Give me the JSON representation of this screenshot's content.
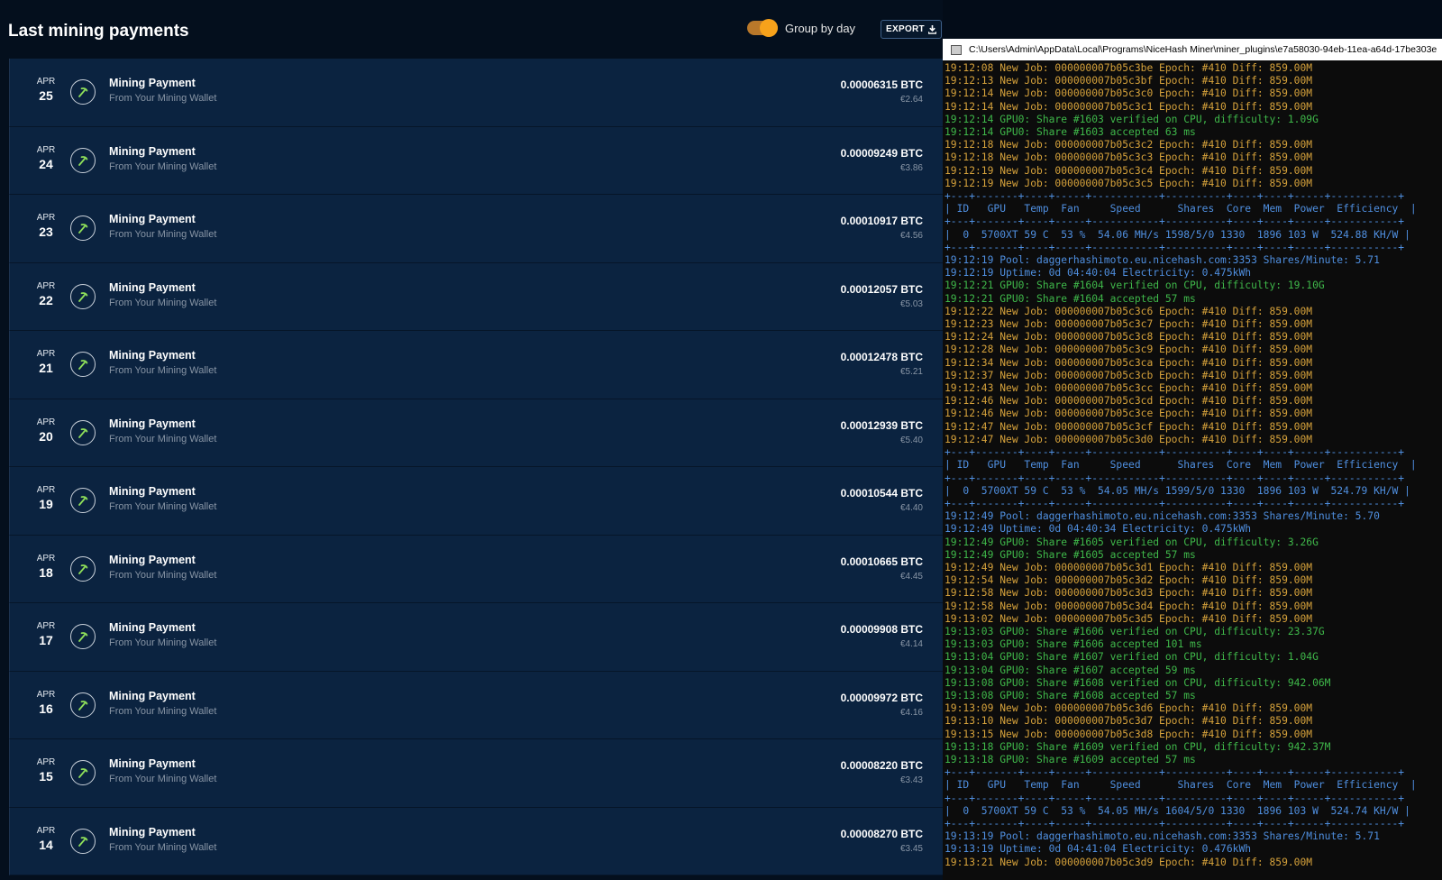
{
  "header": {
    "title": "Last mining payments",
    "group_label": "Group by day",
    "export_label": "EXPORT"
  },
  "colors": {
    "accent": "#f7a21b",
    "row_bg": "#0b2340",
    "icon_green": "#8fe05a"
  },
  "payments": [
    {
      "month": "APR",
      "day": "25",
      "title": "Mining Payment",
      "subtitle": "From Your Mining Wallet",
      "btc": "0.00006315 BTC",
      "eur": "€2.64"
    },
    {
      "month": "APR",
      "day": "24",
      "title": "Mining Payment",
      "subtitle": "From Your Mining Wallet",
      "btc": "0.00009249 BTC",
      "eur": "€3.86"
    },
    {
      "month": "APR",
      "day": "23",
      "title": "Mining Payment",
      "subtitle": "From Your Mining Wallet",
      "btc": "0.00010917 BTC",
      "eur": "€4.56"
    },
    {
      "month": "APR",
      "day": "22",
      "title": "Mining Payment",
      "subtitle": "From Your Mining Wallet",
      "btc": "0.00012057 BTC",
      "eur": "€5.03"
    },
    {
      "month": "APR",
      "day": "21",
      "title": "Mining Payment",
      "subtitle": "From Your Mining Wallet",
      "btc": "0.00012478 BTC",
      "eur": "€5.21"
    },
    {
      "month": "APR",
      "day": "20",
      "title": "Mining Payment",
      "subtitle": "From Your Mining Wallet",
      "btc": "0.00012939 BTC",
      "eur": "€5.40"
    },
    {
      "month": "APR",
      "day": "19",
      "title": "Mining Payment",
      "subtitle": "From Your Mining Wallet",
      "btc": "0.00010544 BTC",
      "eur": "€4.40"
    },
    {
      "month": "APR",
      "day": "18",
      "title": "Mining Payment",
      "subtitle": "From Your Mining Wallet",
      "btc": "0.00010665 BTC",
      "eur": "€4.45"
    },
    {
      "month": "APR",
      "day": "17",
      "title": "Mining Payment",
      "subtitle": "From Your Mining Wallet",
      "btc": "0.00009908 BTC",
      "eur": "€4.14"
    },
    {
      "month": "APR",
      "day": "16",
      "title": "Mining Payment",
      "subtitle": "From Your Mining Wallet",
      "btc": "0.00009972 BTC",
      "eur": "€4.16"
    },
    {
      "month": "APR",
      "day": "15",
      "title": "Mining Payment",
      "subtitle": "From Your Mining Wallet",
      "btc": "0.00008220 BTC",
      "eur": "€3.43"
    },
    {
      "month": "APR",
      "day": "14",
      "title": "Mining Payment",
      "subtitle": "From Your Mining Wallet",
      "btc": "0.00008270 BTC",
      "eur": "€3.45"
    }
  ],
  "console": {
    "title": "C:\\Users\\Admin\\AppData\\Local\\Programs\\NiceHash Miner\\miner_plugins\\e7a58030-94eb-11ea-a64d-17be303e",
    "lines": [
      {
        "t": "job",
        "text": "19:12:08 New Job: 000000007b05c3be Epoch: #410 Diff: 859.00M"
      },
      {
        "t": "job",
        "text": "19:12:13 New Job: 000000007b05c3bf Epoch: #410 Diff: 859.00M"
      },
      {
        "t": "job",
        "text": "19:12:14 New Job: 000000007b05c3c0 Epoch: #410 Diff: 859.00M"
      },
      {
        "t": "job",
        "text": "19:12:14 New Job: 000000007b05c3c1 Epoch: #410 Diff: 859.00M"
      },
      {
        "t": "ok",
        "text": "19:12:14 GPU0: Share #1603 verified on CPU, difficulty: 1.09G"
      },
      {
        "t": "ok",
        "text": "19:12:14 GPU0: Share #1603 accepted 63 ms"
      },
      {
        "t": "job",
        "text": "19:12:18 New Job: 000000007b05c3c2 Epoch: #410 Diff: 859.00M"
      },
      {
        "t": "job",
        "text": "19:12:18 New Job: 000000007b05c3c3 Epoch: #410 Diff: 859.00M"
      },
      {
        "t": "job",
        "text": "19:12:19 New Job: 000000007b05c3c4 Epoch: #410 Diff: 859.00M"
      },
      {
        "t": "job",
        "text": "19:12:19 New Job: 000000007b05c3c5 Epoch: #410 Diff: 859.00M"
      },
      {
        "t": "sep",
        "text": "+---+-------+----+-----+-----------+----------+----+----+-----+-----------+"
      },
      {
        "t": "tbl",
        "text": "| ID   GPU   Temp  Fan     Speed      Shares  Core  Mem  Power  Efficiency  |"
      },
      {
        "t": "sep",
        "text": "+---+-------+----+-----+-----------+----------+----+----+-----+-----------+"
      },
      {
        "t": "tbl",
        "text": "|  0  5700XT 59 C  53 %  54.06 MH/s 1598/5/0 1330  1896 103 W  524.88 KH/W |"
      },
      {
        "t": "sep",
        "text": "+---+-------+----+-----+-----------+----------+----+----+-----+-----------+"
      },
      {
        "t": "info",
        "text": "19:12:19 Pool: daggerhashimoto.eu.nicehash.com:3353 Shares/Minute: 5.71"
      },
      {
        "t": "info",
        "text": "19:12:19 Uptime: 0d 04:40:04 Electricity: 0.475kWh"
      },
      {
        "t": "ok",
        "text": "19:12:21 GPU0: Share #1604 verified on CPU, difficulty: 19.10G"
      },
      {
        "t": "ok",
        "text": "19:12:21 GPU0: Share #1604 accepted 57 ms"
      },
      {
        "t": "job",
        "text": "19:12:22 New Job: 000000007b05c3c6 Epoch: #410 Diff: 859.00M"
      },
      {
        "t": "job",
        "text": "19:12:23 New Job: 000000007b05c3c7 Epoch: #410 Diff: 859.00M"
      },
      {
        "t": "job",
        "text": "19:12:24 New Job: 000000007b05c3c8 Epoch: #410 Diff: 859.00M"
      },
      {
        "t": "job",
        "text": "19:12:28 New Job: 000000007b05c3c9 Epoch: #410 Diff: 859.00M"
      },
      {
        "t": "job",
        "text": "19:12:34 New Job: 000000007b05c3ca Epoch: #410 Diff: 859.00M"
      },
      {
        "t": "job",
        "text": "19:12:37 New Job: 000000007b05c3cb Epoch: #410 Diff: 859.00M"
      },
      {
        "t": "job",
        "text": "19:12:43 New Job: 000000007b05c3cc Epoch: #410 Diff: 859.00M"
      },
      {
        "t": "job",
        "text": "19:12:46 New Job: 000000007b05c3cd Epoch: #410 Diff: 859.00M"
      },
      {
        "t": "job",
        "text": "19:12:46 New Job: 000000007b05c3ce Epoch: #410 Diff: 859.00M"
      },
      {
        "t": "job",
        "text": "19:12:47 New Job: 000000007b05c3cf Epoch: #410 Diff: 859.00M"
      },
      {
        "t": "job",
        "text": "19:12:47 New Job: 000000007b05c3d0 Epoch: #410 Diff: 859.00M"
      },
      {
        "t": "sep",
        "text": "+---+-------+----+-----+-----------+----------+----+----+-----+-----------+"
      },
      {
        "t": "tbl",
        "text": "| ID   GPU   Temp  Fan     Speed      Shares  Core  Mem  Power  Efficiency  |"
      },
      {
        "t": "sep",
        "text": "+---+-------+----+-----+-----------+----------+----+----+-----+-----------+"
      },
      {
        "t": "tbl",
        "text": "|  0  5700XT 59 C  53 %  54.05 MH/s 1599/5/0 1330  1896 103 W  524.79 KH/W |"
      },
      {
        "t": "sep",
        "text": "+---+-------+----+-----+-----------+----------+----+----+-----+-----------+"
      },
      {
        "t": "info",
        "text": "19:12:49 Pool: daggerhashimoto.eu.nicehash.com:3353 Shares/Minute: 5.70"
      },
      {
        "t": "info",
        "text": "19:12:49 Uptime: 0d 04:40:34 Electricity: 0.475kWh"
      },
      {
        "t": "ok",
        "text": "19:12:49 GPU0: Share #1605 verified on CPU, difficulty: 3.26G"
      },
      {
        "t": "ok",
        "text": "19:12:49 GPU0: Share #1605 accepted 57 ms"
      },
      {
        "t": "job",
        "text": "19:12:49 New Job: 000000007b05c3d1 Epoch: #410 Diff: 859.00M"
      },
      {
        "t": "job",
        "text": "19:12:54 New Job: 000000007b05c3d2 Epoch: #410 Diff: 859.00M"
      },
      {
        "t": "job",
        "text": "19:12:58 New Job: 000000007b05c3d3 Epoch: #410 Diff: 859.00M"
      },
      {
        "t": "job",
        "text": "19:12:58 New Job: 000000007b05c3d4 Epoch: #410 Diff: 859.00M"
      },
      {
        "t": "job",
        "text": "19:13:02 New Job: 000000007b05c3d5 Epoch: #410 Diff: 859.00M"
      },
      {
        "t": "ok",
        "text": "19:13:03 GPU0: Share #1606 verified on CPU, difficulty: 23.37G"
      },
      {
        "t": "ok",
        "text": "19:13:03 GPU0: Share #1606 accepted 101 ms"
      },
      {
        "t": "ok",
        "text": "19:13:04 GPU0: Share #1607 verified on CPU, difficulty: 1.04G"
      },
      {
        "t": "ok",
        "text": "19:13:04 GPU0: Share #1607 accepted 59 ms"
      },
      {
        "t": "ok",
        "text": "19:13:08 GPU0: Share #1608 verified on CPU, difficulty: 942.06M"
      },
      {
        "t": "ok",
        "text": "19:13:08 GPU0: Share #1608 accepted 57 ms"
      },
      {
        "t": "job",
        "text": "19:13:09 New Job: 000000007b05c3d6 Epoch: #410 Diff: 859.00M"
      },
      {
        "t": "job",
        "text": "19:13:10 New Job: 000000007b05c3d7 Epoch: #410 Diff: 859.00M"
      },
      {
        "t": "job",
        "text": "19:13:15 New Job: 000000007b05c3d8 Epoch: #410 Diff: 859.00M"
      },
      {
        "t": "ok",
        "text": "19:13:18 GPU0: Share #1609 verified on CPU, difficulty: 942.37M"
      },
      {
        "t": "ok",
        "text": "19:13:18 GPU0: Share #1609 accepted 57 ms"
      },
      {
        "t": "sep",
        "text": "+---+-------+----+-----+-----------+----------+----+----+-----+-----------+"
      },
      {
        "t": "tbl",
        "text": "| ID   GPU   Temp  Fan     Speed      Shares  Core  Mem  Power  Efficiency  |"
      },
      {
        "t": "sep",
        "text": "+---+-------+----+-----+-----------+----------+----+----+-----+-----------+"
      },
      {
        "t": "tbl",
        "text": "|  0  5700XT 59 C  53 %  54.05 MH/s 1604/5/0 1330  1896 103 W  524.74 KH/W |"
      },
      {
        "t": "sep",
        "text": "+---+-------+----+-----+-----------+----------+----+----+-----+-----------+"
      },
      {
        "t": "info",
        "text": "19:13:19 Pool: daggerhashimoto.eu.nicehash.com:3353 Shares/Minute: 5.71"
      },
      {
        "t": "info",
        "text": "19:13:19 Uptime: 0d 04:41:04 Electricity: 0.476kWh"
      },
      {
        "t": "job",
        "text": "19:13:21 New Job: 000000007b05c3d9 Epoch: #410 Diff: 859.00M"
      }
    ]
  }
}
